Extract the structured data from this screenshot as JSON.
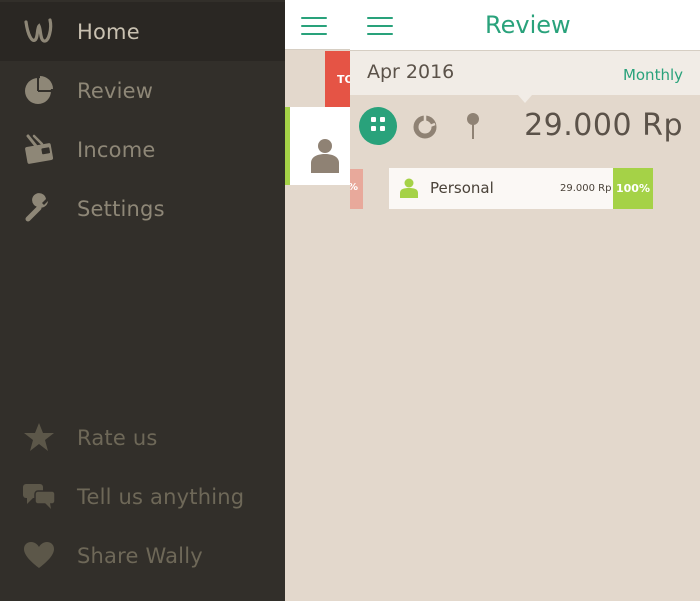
{
  "sidebar": {
    "items": [
      {
        "label": "Home",
        "icon": "wally-logo-icon",
        "active": true
      },
      {
        "label": "Review",
        "icon": "pie-chart-icon"
      },
      {
        "label": "Income",
        "icon": "wallet-icon"
      },
      {
        "label": "Settings",
        "icon": "wrench-icon"
      }
    ],
    "footer_items": [
      {
        "label": "Rate us",
        "icon": "star-icon"
      },
      {
        "label": "Tell us anything",
        "icon": "chat-bubbles-icon"
      },
      {
        "label": "Share Wally",
        "icon": "heart-icon"
      }
    ]
  },
  "underlay": {
    "red_strip_text": "TO",
    "pct_strip_text": "%"
  },
  "review": {
    "title": "Review",
    "month": "Apr 2016",
    "period": "Monthly",
    "total": "29.000 Rp",
    "categories": [
      {
        "name": "Personal",
        "amount": "29.000 Rp",
        "percent": "100%",
        "icon": "person-icon"
      }
    ]
  },
  "colors": {
    "accent": "#29a27b",
    "sidebar_bg": "#322f2a",
    "content_bg": "#e3d8cc",
    "bar_green": "#a5d247",
    "red": "#e55445"
  }
}
